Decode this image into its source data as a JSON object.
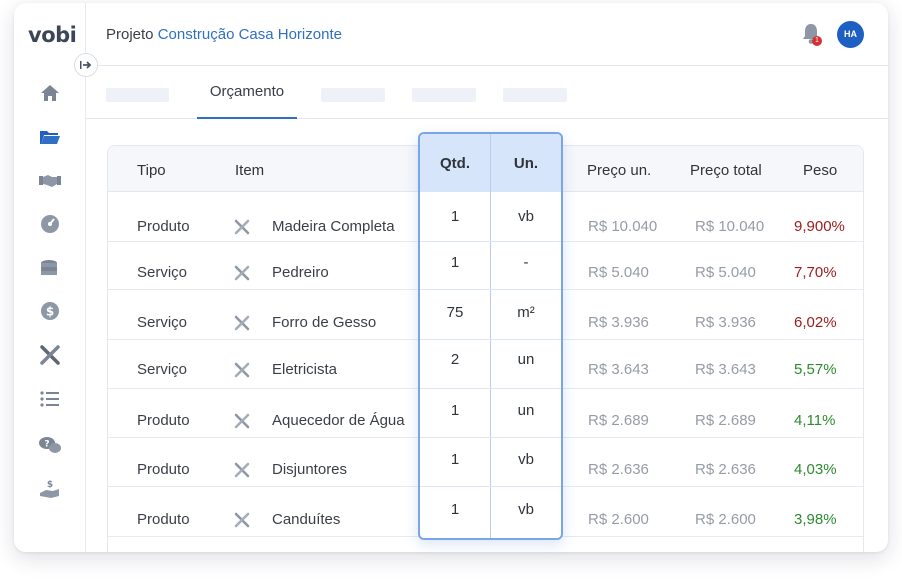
{
  "app": {
    "logo": "vobi"
  },
  "header": {
    "project_prefix": "Projeto",
    "project_name": "Construção Casa Horizonte",
    "notification_count": "1",
    "avatar_initials": "HA"
  },
  "tabs": {
    "active_label": "Orçamento"
  },
  "table": {
    "columns": {
      "tipo": "Tipo",
      "item": "Item",
      "qtd": "Qtd.",
      "un": "Un.",
      "preco_un": "Preço un.",
      "preco_total": "Preço total",
      "peso": "Peso"
    },
    "rows": [
      {
        "tipo": "Produto",
        "item": "Madeira Completa",
        "qtd": "1",
        "un": "vb",
        "preco_un": "R$ 10.040",
        "preco_total": "R$ 10.040",
        "peso": "9,900%",
        "peso_color": "#9b1b1b"
      },
      {
        "tipo": "Serviço",
        "item": "Pedreiro",
        "qtd": "1",
        "un": "-",
        "preco_un": "R$ 5.040",
        "preco_total": "R$ 5.040",
        "peso": "7,70%",
        "peso_color": "#9b1b1b"
      },
      {
        "tipo": "Serviço",
        "item": "Forro de Gesso",
        "qtd": "75",
        "un": "m²",
        "preco_un": "R$ 3.936",
        "preco_total": "R$ 3.936",
        "peso": "6,02%",
        "peso_color": "#9b1b1b"
      },
      {
        "tipo": "Serviço",
        "item": "Eletricista",
        "qtd": "2",
        "un": "un",
        "preco_un": "R$ 3.643",
        "preco_total": "R$ 3.643",
        "peso": "5,57%",
        "peso_color": "#2e8a2e"
      },
      {
        "tipo": "Produto",
        "item": "Aquecedor de Água",
        "qtd": "1",
        "un": "un",
        "preco_un": "R$ 2.689",
        "preco_total": "R$ 2.689",
        "peso": "4,11%",
        "peso_color": "#2e8a2e"
      },
      {
        "tipo": "Produto",
        "item": "Disjuntores",
        "qtd": "1",
        "un": "vb",
        "preco_un": "R$ 2.636",
        "preco_total": "R$ 2.636",
        "peso": "4,03%",
        "peso_color": "#2e8a2e"
      },
      {
        "tipo": "Produto",
        "item": "Canduítes",
        "qtd": "1",
        "un": "vb",
        "preco_un": "R$ 2.600",
        "preco_total": "R$ 2.600",
        "peso": "3,98%",
        "peso_color": "#2e8a2e"
      }
    ]
  },
  "colors": {
    "accent": "#2f6fc4",
    "highlight_border": "#7aa6e6",
    "highlight_header": "#d6e5fa"
  },
  "sidebar_icons": [
    "home-icon",
    "folder-icon",
    "handshake-icon",
    "dashboard-gauge-icon",
    "coins-icon",
    "dollar-icon",
    "tools-icon",
    "list-icon",
    "chat-question-icon",
    "hand-money-icon"
  ]
}
